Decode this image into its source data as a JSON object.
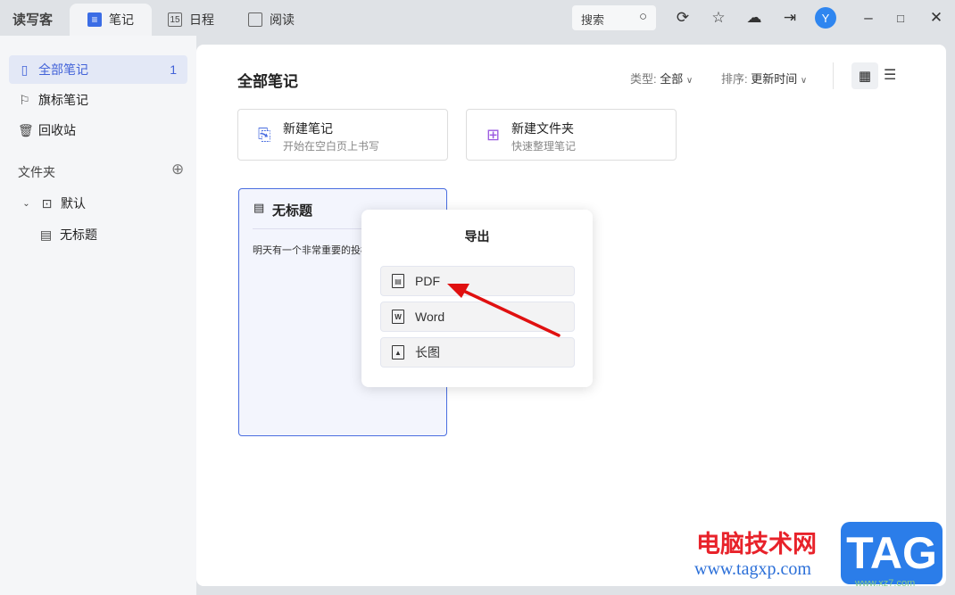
{
  "app": {
    "name": "读写客"
  },
  "tabs": [
    {
      "label": "笔记",
      "icon": "≡"
    },
    {
      "label": "日程",
      "icon": "15"
    },
    {
      "label": "阅读",
      "icon": ""
    }
  ],
  "toolbar": {
    "search_placeholder": "搜索",
    "avatar": "Y"
  },
  "sidebar": {
    "items": [
      {
        "label": "全部笔记",
        "count": "1"
      },
      {
        "label": "旗标笔记"
      },
      {
        "label": "回收站"
      }
    ],
    "folder_header": "文件夹",
    "folders": [
      {
        "label": "默认",
        "children": [
          {
            "label": "无标题"
          }
        ]
      }
    ]
  },
  "main": {
    "title": "全部笔记",
    "type_label": "类型:",
    "type_value": "全部",
    "sort_label": "排序:",
    "sort_value": "更新时间",
    "cards": [
      {
        "title": "新建笔记",
        "subtitle": "开始在空白页上书写"
      },
      {
        "title": "新建文件夹",
        "subtitle": "快速整理笔记"
      }
    ],
    "notes": [
      {
        "title": "无标题",
        "preview": "明天有一个非常重要的投标"
      }
    ]
  },
  "export_popup": {
    "title": "导出",
    "options": [
      {
        "label": "PDF"
      },
      {
        "label": "Word"
      },
      {
        "label": "长图"
      }
    ]
  },
  "watermark": {
    "line1": "电脑技术网",
    "line2": "www.tagxp.com",
    "logo": "TAG",
    "sub": "www.xz7.com"
  },
  "colors": {
    "accent": "#3b6de5",
    "arrow": "#e01010"
  }
}
